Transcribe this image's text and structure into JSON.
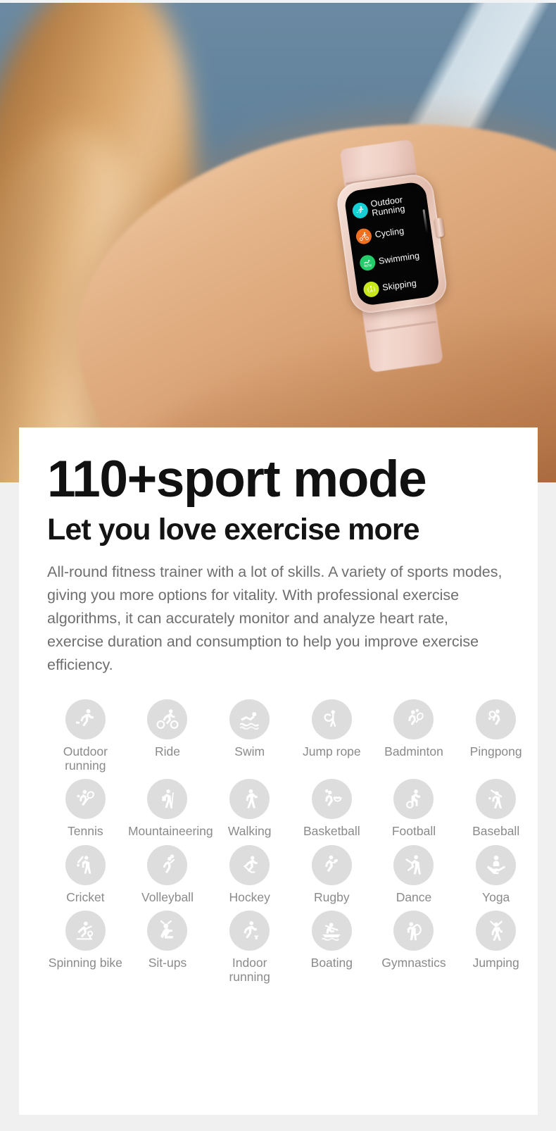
{
  "hero": {
    "alt": "Woman wearing a pink smartwatch on her wrist against a blue tennis court background",
    "watch": {
      "sports": [
        {
          "label": "Outdoor Running",
          "color": "#14cfd4",
          "icon": "running-icon"
        },
        {
          "label": "Cycling",
          "color": "#f06f20",
          "icon": "cycling-icon"
        },
        {
          "label": "Swimming",
          "color": "#25cd6a",
          "icon": "swimming-icon"
        },
        {
          "label": "Skipping",
          "color": "#c9e81c",
          "icon": "skipping-icon"
        }
      ]
    }
  },
  "card": {
    "title": "110+sport mode",
    "subtitle": "Let you love exercise more",
    "paragraph": "All-round fitness trainer with a lot of skills. A variety of sports modes, giving you more options for vitality. With professional exercise algorithms, it can accurately monitor and analyze heart rate, exercise duration and consumption to help you improve exercise efficiency.",
    "sports": [
      {
        "label": "Outdoor running",
        "icon": "running-icon"
      },
      {
        "label": "Ride",
        "icon": "cycling-icon"
      },
      {
        "label": "Swim",
        "icon": "swimming-icon"
      },
      {
        "label": "Jump rope",
        "icon": "jump-rope-icon"
      },
      {
        "label": "Badminton",
        "icon": "badminton-icon"
      },
      {
        "label": "Pingpong",
        "icon": "pingpong-icon"
      },
      {
        "label": "Tennis",
        "icon": "tennis-icon"
      },
      {
        "label": "Mountaineering",
        "icon": "mountaineering-icon"
      },
      {
        "label": "Walking",
        "icon": "walking-icon"
      },
      {
        "label": "Basketball",
        "icon": "basketball-icon"
      },
      {
        "label": "Football",
        "icon": "football-icon"
      },
      {
        "label": "Baseball",
        "icon": "baseball-icon"
      },
      {
        "label": "Cricket",
        "icon": "cricket-icon"
      },
      {
        "label": "Volleyball",
        "icon": "volleyball-icon"
      },
      {
        "label": "Hockey",
        "icon": "hockey-icon"
      },
      {
        "label": "Rugby",
        "icon": "rugby-icon"
      },
      {
        "label": "Dance",
        "icon": "dance-icon"
      },
      {
        "label": "Yoga",
        "icon": "yoga-icon"
      },
      {
        "label": "Spinning bike",
        "icon": "spinning-bike-icon"
      },
      {
        "label": "Sit-ups",
        "icon": "sit-ups-icon"
      },
      {
        "label": "Indoor running",
        "icon": "indoor-running-icon"
      },
      {
        "label": "Boating",
        "icon": "boating-icon"
      },
      {
        "label": "Gymnastics",
        "icon": "gymnastics-icon"
      },
      {
        "label": "Jumping",
        "icon": "jumping-icon"
      }
    ]
  },
  "colors": {
    "page_background": "#f0f0f0",
    "card_background": "#ffffff",
    "photo_blue": "#5d7f99",
    "icon_circle": "#dddddd",
    "label_gray": "#8a8a8a",
    "paragraph_gray": "#6e6e6e"
  }
}
